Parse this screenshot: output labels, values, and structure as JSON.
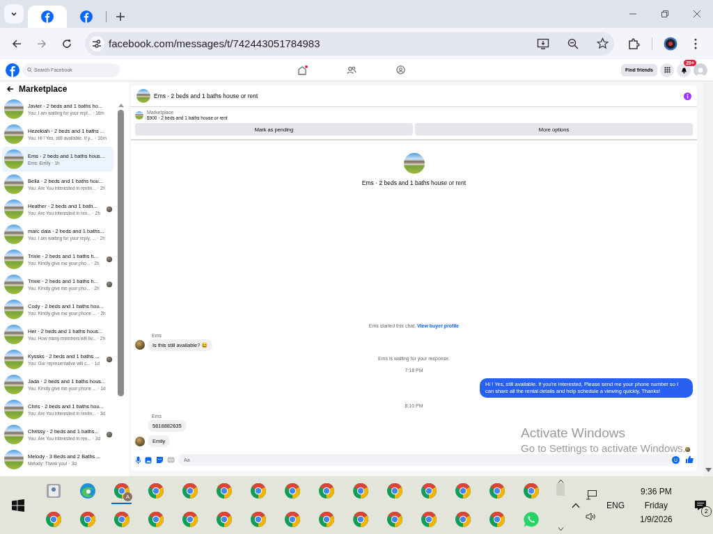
{
  "browser": {
    "tabs": [
      {
        "selected": true
      },
      {
        "selected": false
      }
    ],
    "url": "facebook.com/messages/t/742443051784983"
  },
  "topbar": {
    "search_placeholder": "Search Facebook",
    "find_friends": "Find friends",
    "notification_count": "20+"
  },
  "sidebar": {
    "title": "Marketplace",
    "conversations": [
      {
        "title": "Javier · 2 beds and 1 baths ho...",
        "preview": "You: I am waiting for your repl...",
        "time": "· 16m",
        "selected": false,
        "read_receipt": false
      },
      {
        "title": "Hezekiah · 2 beds and 1 baths ...",
        "preview": "You: Hi ! Yes, still available. If y...",
        "time": "· 16m",
        "selected": false,
        "read_receipt": false
      },
      {
        "title": "Ems · 2 beds and 1 baths hous...",
        "preview": "Ems: Emily",
        "time": "· 1h",
        "selected": true,
        "read_receipt": false
      },
      {
        "title": "Bella · 2 beds and 1 baths hou...",
        "preview": "You: Are You interested in rentin...",
        "time": "· 2h",
        "selected": false,
        "read_receipt": false
      },
      {
        "title": "Heather · 2 beds and 1 bath...",
        "preview": "You: Are You interested in ren...",
        "time": "· 2h",
        "selected": false,
        "read_receipt": true
      },
      {
        "title": "marc dala · 2 beds and 1 baths...",
        "preview": "You: I am waiting for your reply, ...",
        "time": "· 2h",
        "selected": false,
        "read_receipt": false
      },
      {
        "title": "Trixie · 2 beds and 1 baths h...",
        "preview": "You: Kindly give me your pho...",
        "time": "· 2h",
        "selected": false,
        "read_receipt": true
      },
      {
        "title": "Trixie · 2 beds and 1 baths h...",
        "preview": "You: Kindly give me your pho...",
        "time": "· 2h",
        "selected": false,
        "read_receipt": true
      },
      {
        "title": "Cody · 2 beds and 1 baths hou...",
        "preview": "You: Kindly give me your phone ...",
        "time": "· 2h",
        "selected": false,
        "read_receipt": false
      },
      {
        "title": "Her · 2 beds and 1 baths hous...",
        "preview": "You: How many members will liv...",
        "time": "· 2h",
        "selected": false,
        "read_receipt": false
      },
      {
        "title": "Kyssks · 2 beds and 1 baths ...",
        "preview": "You: Our representative will c...",
        "time": "· 1d",
        "selected": false,
        "read_receipt": true
      },
      {
        "title": "Jada · 2 beds and 1 baths hous...",
        "preview": "You: Kindly give me your phone ...",
        "time": "· 1d",
        "selected": false,
        "read_receipt": false
      },
      {
        "title": "Chris · 2 beds and 1 baths hou...",
        "preview": "You: Are You interested in rentin...",
        "time": "· 3d",
        "selected": false,
        "read_receipt": false
      },
      {
        "title": "Chrissy · 2 beds and 1 baths...",
        "preview": "You: Are You interested in ren...",
        "time": "· 3d",
        "selected": false,
        "read_receipt": true
      },
      {
        "title": "Melody · 3 Beds and 2 Baths ...",
        "preview": "Melody: Thank you!",
        "time": "· 3d",
        "selected": false,
        "read_receipt": false
      }
    ]
  },
  "chat": {
    "title": "Ems · 2 beds and 1 baths house or rent",
    "listing_label": "Marketplace",
    "listing": "$900 · 2 beds and 1 baths house or rent",
    "buttons": [
      "Mark as pending",
      "More options"
    ],
    "profile_title": "Ems · 2 beds and 1 baths house or rent",
    "messages": [
      {
        "kind": "system",
        "text": "Ems started this chat.",
        "link": "View buyer profile"
      },
      {
        "kind": "sender",
        "text": "Ems"
      },
      {
        "kind": "incoming",
        "text": "Is this still available? 😀",
        "avatar": true
      },
      {
        "kind": "system",
        "text": "Ems is waiting for your response."
      },
      {
        "kind": "time",
        "text": "7:18 PM"
      },
      {
        "kind": "outgoing",
        "text": "Hi ! Yes, still available. If you're interested, Please send me your phone number so I can share all the rental details and help schedule a viewing quickly, Thanks!"
      },
      {
        "kind": "time",
        "text": "8:10 PM"
      },
      {
        "kind": "sender",
        "text": "Ems"
      },
      {
        "kind": "incoming",
        "text": "5618882635",
        "avatar": false
      },
      {
        "kind": "incoming",
        "text": "Emily",
        "avatar": true
      }
    ],
    "composer": {
      "placeholder": "Aa",
      "read_receipt": true
    }
  },
  "activation": {
    "title": "Activate Windows",
    "subtitle": "Go to Settings to activate Windows."
  },
  "taskbar": {
    "rows": [
      [
        {
          "kind": "files",
          "selected": false
        },
        {
          "kind": "edge",
          "selected": false
        },
        {
          "kind": "chrome",
          "badge": "A",
          "selected": true
        },
        {
          "kind": "chrome",
          "selected": false
        },
        {
          "kind": "chrome",
          "selected": false
        },
        {
          "kind": "chrome",
          "selected": false
        },
        {
          "kind": "chrome",
          "selected": false
        },
        {
          "kind": "chrome",
          "selected": false
        },
        {
          "kind": "chrome",
          "selected": false
        },
        {
          "kind": "chrome",
          "selected": false
        },
        {
          "kind": "chrome",
          "selected": false
        },
        {
          "kind": "chrome",
          "selected": false
        },
        {
          "kind": "chrome",
          "selected": false
        },
        {
          "kind": "chrome",
          "selected": false
        },
        {
          "kind": "chrome",
          "selected": false
        }
      ],
      [
        {
          "kind": "chrome",
          "selected": false
        },
        {
          "kind": "chrome",
          "selected": false
        },
        {
          "kind": "chrome",
          "selected": false
        },
        {
          "kind": "chrome",
          "selected": false
        },
        {
          "kind": "chrome",
          "selected": false
        },
        {
          "kind": "chrome",
          "selected": false
        },
        {
          "kind": "chrome",
          "selected": false
        },
        {
          "kind": "chrome",
          "selected": false
        },
        {
          "kind": "chrome",
          "selected": false
        },
        {
          "kind": "chrome",
          "selected": false
        },
        {
          "kind": "chrome",
          "selected": false
        },
        {
          "kind": "chrome",
          "selected": false
        },
        {
          "kind": "chrome",
          "selected": false
        },
        {
          "kind": "chrome",
          "selected": false
        },
        {
          "kind": "whatsapp",
          "selected": false
        }
      ]
    ],
    "language": "ENG",
    "time": "9:36 PM",
    "day": "Friday",
    "date": "1/9/2026",
    "notifications": "2"
  }
}
